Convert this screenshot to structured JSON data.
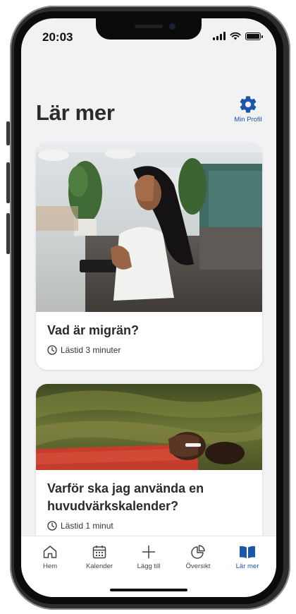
{
  "status_bar": {
    "time": "20:03"
  },
  "header": {
    "title": "Lär mer",
    "profile_label": "Min Profil"
  },
  "articles": [
    {
      "title": "Vad är migrän?",
      "read_time": "Lästid 3 minuter"
    },
    {
      "title": "Varför ska jag använda en huvudvärkskalender?",
      "read_time": "Lästid 1 minut"
    }
  ],
  "tabbar": {
    "items": [
      {
        "label": "Hem",
        "icon": "home-icon"
      },
      {
        "label": "Kalender",
        "icon": "calendar-icon"
      },
      {
        "label": "Lägg till",
        "icon": "plus-icon"
      },
      {
        "label": "Översikt",
        "icon": "pie-chart-icon"
      },
      {
        "label": "Lär mer",
        "icon": "book-icon"
      }
    ],
    "active_index": 4
  },
  "colors": {
    "accent": "#1b57a8",
    "background": "#f2f2f4",
    "card": "#ffffff",
    "text": "#2b2b2b"
  }
}
